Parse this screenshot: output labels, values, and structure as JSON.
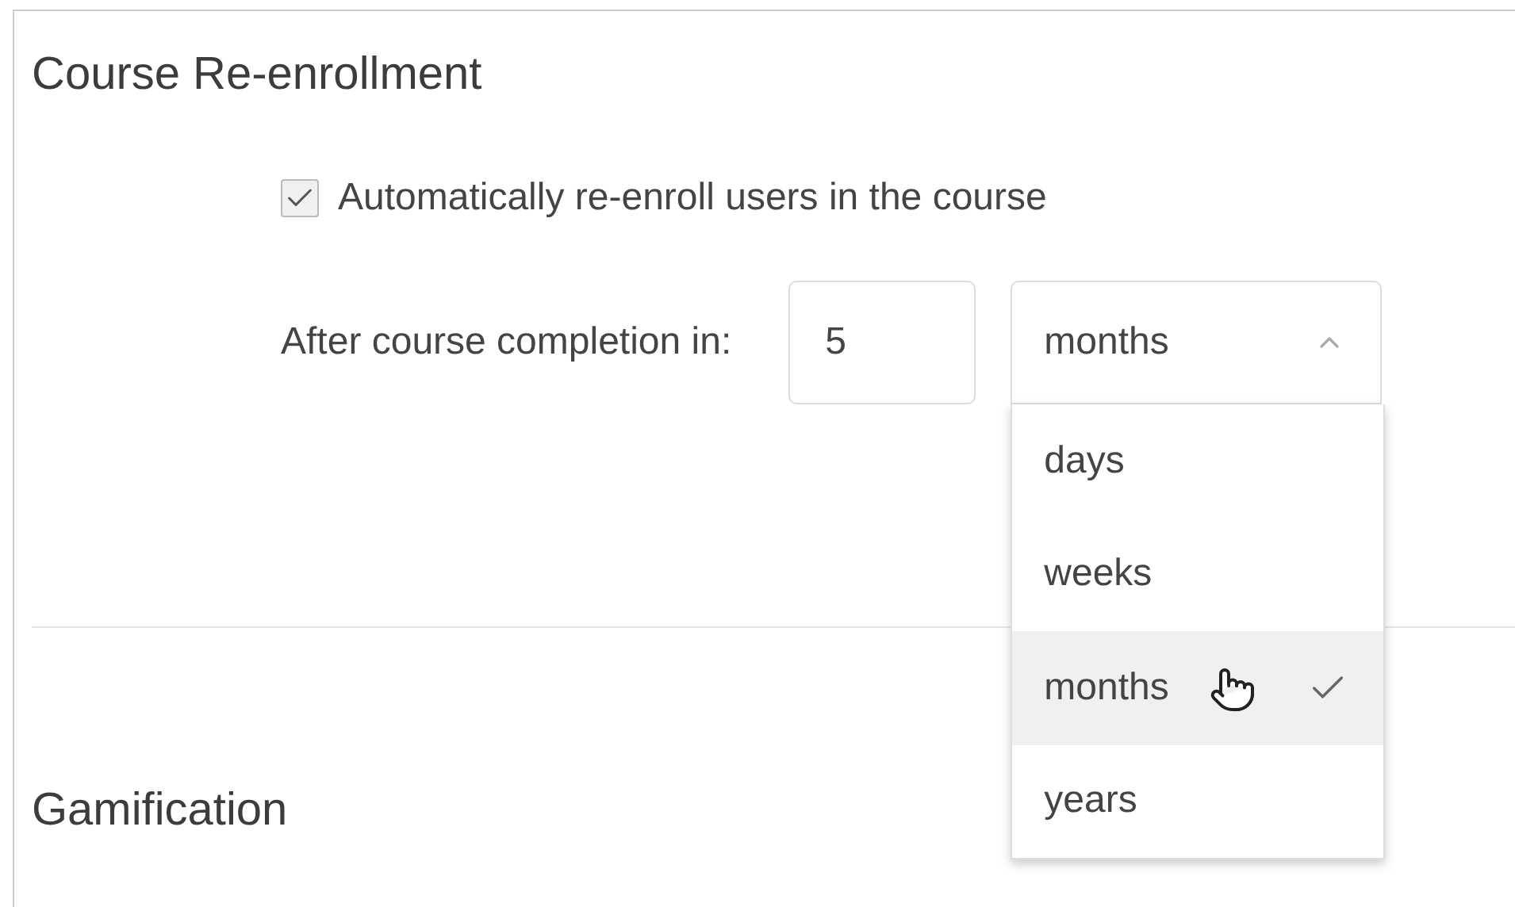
{
  "section_title": "Course Re-enrollment",
  "auto_reenroll": {
    "label": "Automatically re-enroll users in the course",
    "checked": true
  },
  "completion": {
    "label": "After course completion in:",
    "value": "5",
    "unit": {
      "value": "months",
      "expanded": true,
      "options": [
        {
          "label": "days",
          "selected": false
        },
        {
          "label": "weeks",
          "selected": false
        },
        {
          "label": "months",
          "selected": true
        },
        {
          "label": "years",
          "selected": false
        }
      ]
    }
  },
  "next_section_title": "Gamification"
}
